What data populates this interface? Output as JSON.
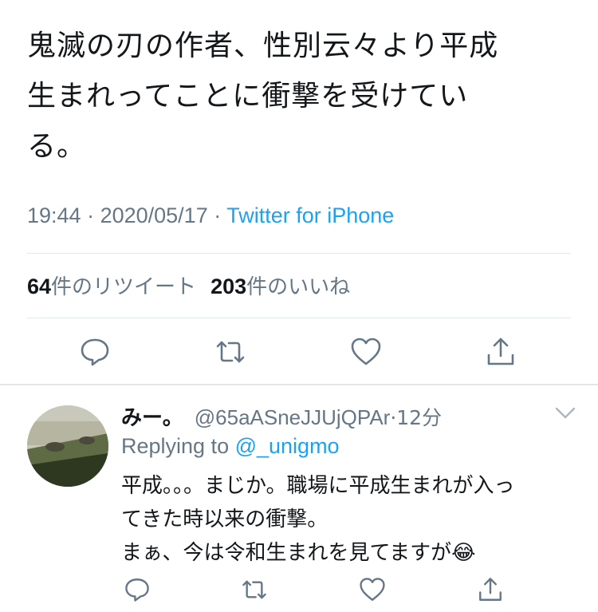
{
  "tweet": {
    "text": "鬼滅の刃の作者、性別云々より平成\n生まれってことに衝撃を受けてい\nる。",
    "time": "19:44",
    "date": "2020/05/17",
    "source": "Twitter for iPhone",
    "sep": " · "
  },
  "stats": {
    "retweets_count": "64",
    "retweets_label": "件のリツイート",
    "likes_count": "203",
    "likes_label": "件のいいね"
  },
  "actions": [
    "reply-icon",
    "retweet-icon",
    "like-icon",
    "share-icon"
  ],
  "reply": {
    "name": "みー。",
    "handle": "@65aASneJJUjQPAr",
    "time": "12分",
    "sep": "·",
    "replying_prefix": "Replying to ",
    "replying_to": "@_unigmo",
    "text": "平成。。。まじか。職場に平成生まれが入っ\nてきた時以来の衝撃。\nまぁ、今は令和生まれを見てますが😂"
  },
  "colors": {
    "accent": "#1da1f2",
    "muted": "#657786",
    "divider": "#e1e8ed"
  }
}
